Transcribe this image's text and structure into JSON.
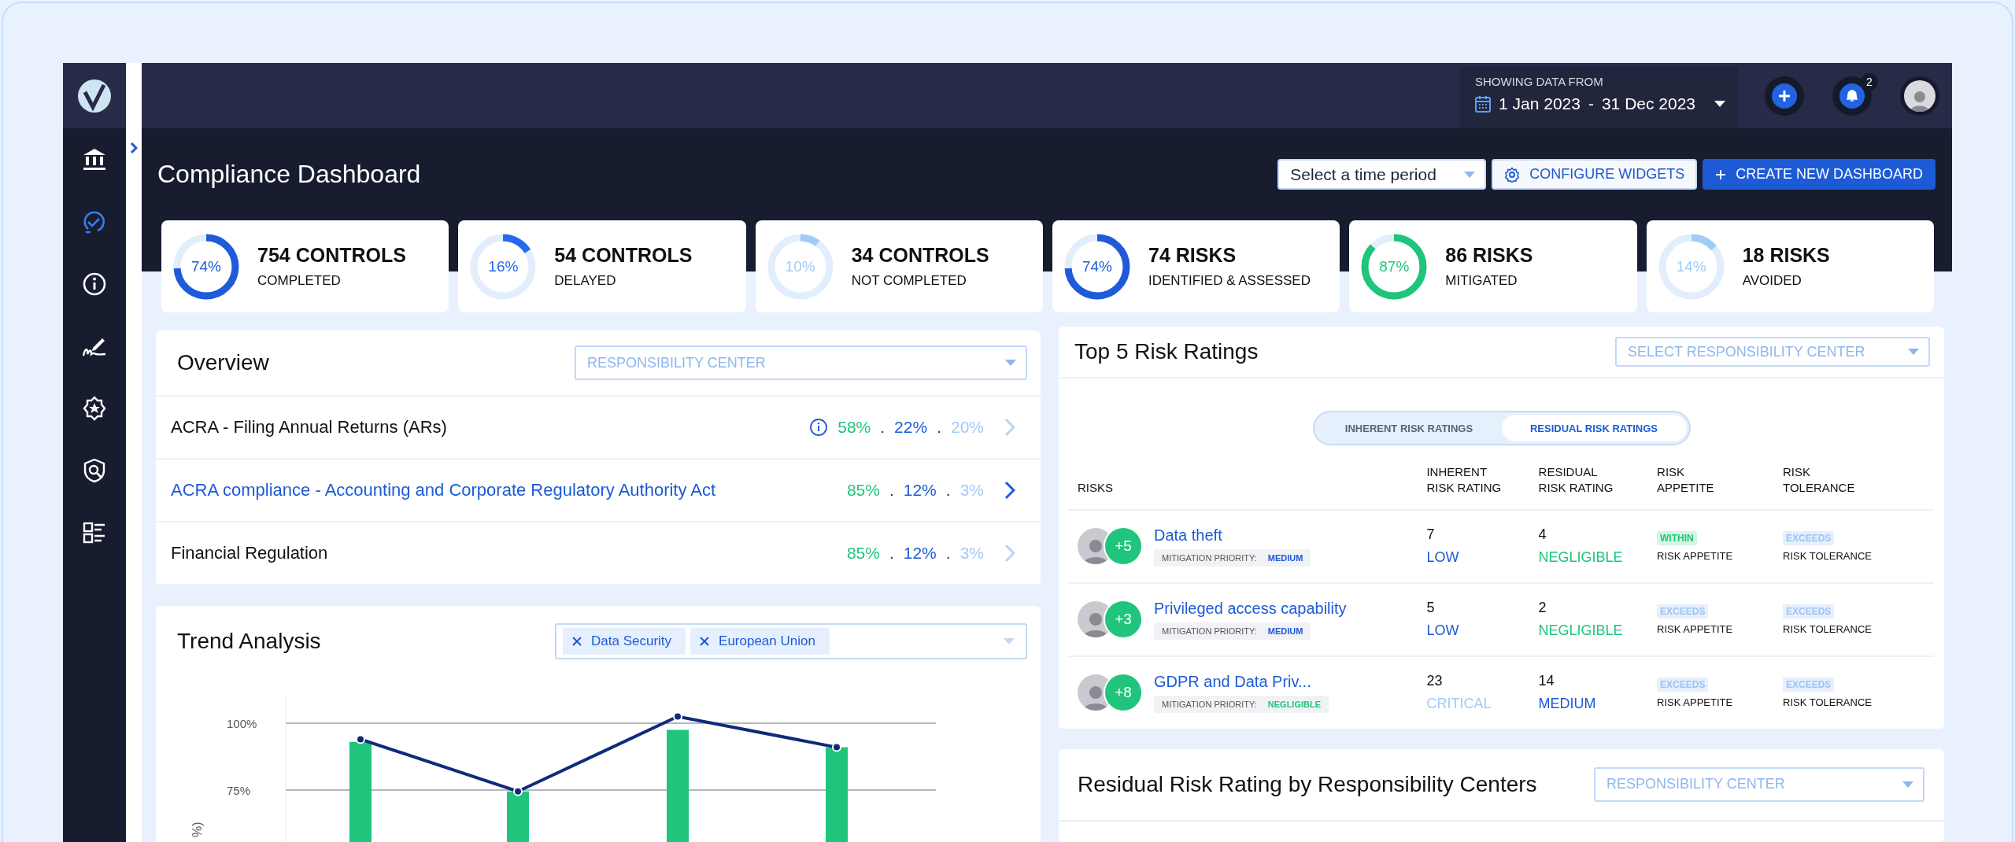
{
  "header": {
    "date_label": "SHOWING DATA FROM",
    "date_start": "1 Jan 2023",
    "date_separator": "-",
    "date_end": "31 Dec 2023",
    "notification_count": "2"
  },
  "sidebar": {
    "items": [
      {
        "kind": "bank",
        "selected": false
      },
      {
        "kind": "check",
        "selected": true
      },
      {
        "kind": "info",
        "selected": false
      },
      {
        "kind": "signature",
        "selected": false
      },
      {
        "kind": "badge",
        "selected": false
      },
      {
        "kind": "shield",
        "selected": false
      },
      {
        "kind": "list",
        "selected": false
      }
    ]
  },
  "page": {
    "title": "Compliance Dashboard",
    "time_period": {
      "placeholder": "Select a time period"
    },
    "buttons": [
      {
        "label": "CONFIGURE WIDGETS",
        "kind": "configure"
      },
      {
        "label": "CREATE NEW DASHBOARD",
        "kind": "create"
      }
    ]
  },
  "kpis": [
    {
      "percent": "74%",
      "level": 0.74,
      "color": "#1f5ad8",
      "value": "754 CONTROLS",
      "label": "COMPLETED"
    },
    {
      "percent": "16%",
      "level": 0.16,
      "color": "#2569f0",
      "value": "54 CONTROLS",
      "label": "DELAYED"
    },
    {
      "percent": "10%",
      "level": 0.1,
      "color": "#a1cbf8",
      "value": "34 CONTROLS",
      "label": "NOT COMPLETED"
    },
    {
      "percent": "74%",
      "level": 0.74,
      "color": "#1f5ad8",
      "value": "74 RISKS",
      "label": "IDENTIFIED & ASSESSED"
    },
    {
      "percent": "87%",
      "level": 0.87,
      "color": "#20c47c",
      "value": "86 RISKS",
      "label": "MITIGATED"
    },
    {
      "percent": "14%",
      "level": 0.14,
      "color": "#a1cbf8",
      "value": "18 RISKS",
      "label": "AVOIDED"
    }
  ],
  "overview": {
    "title": "Overview",
    "filter": {
      "placeholder": "RESPONSIBILITY CENTER"
    },
    "separator": ".",
    "rows": [
      {
        "name": "ACRA - Filing Annual Returns (ARs)",
        "selected": false,
        "info": true,
        "value_1": "58%",
        "value_2": "22%",
        "value_3": "20%"
      },
      {
        "name": "ACRA compliance - Accounting and Corporate Regulatory Authority Act",
        "selected": true,
        "info": false,
        "value_1": "85%",
        "value_2": "12%",
        "value_3": "3%"
      },
      {
        "name": "Financial Regulation",
        "selected": false,
        "info": false,
        "value_1": "85%",
        "value_2": "12%",
        "value_3": "3%"
      }
    ]
  },
  "trend": {
    "title": "Trend Analysis",
    "filters": [
      {
        "label": "Data Security"
      },
      {
        "label": "European Union"
      }
    ],
    "chart_data": {
      "type": "bar",
      "ylabel": "%)",
      "ylim": [
        0,
        110
      ],
      "yticks": [
        {
          "value": 75,
          "label": "75%"
        },
        {
          "value": 100,
          "label": "100%"
        }
      ],
      "series": [
        {
          "type": "bar",
          "color": "#20c47c",
          "values": [
            93,
            74.5,
            97.5,
            91
          ]
        },
        {
          "type": "line",
          "color": "#0d2b7a",
          "marker": true,
          "values": [
            94,
            74.5,
            102.5,
            91
          ]
        }
      ]
    }
  },
  "top_risks": {
    "title": "Top 5 Risk Ratings",
    "filter": {
      "placeholder": "SELECT RESPONSIBILITY CENTER"
    },
    "toggle": [
      {
        "label": "INHERENT RISK RATINGS",
        "selected": false
      },
      {
        "label": "RESIDUAL RISK RATINGS",
        "selected": true
      }
    ],
    "columns": [
      "RISKS",
      "INHERENT\nRISK RATING",
      "RESIDUAL\nRISK RATING",
      "RISK\nAPPETITE",
      "RISK\nTOLERANCE"
    ],
    "rows": [
      {
        "extra_count": "+5",
        "name": "Data theft",
        "priority": {
          "label": "MITIGATION PRIORITY:",
          "value": "MEDIUM",
          "color": "#1d5ad6"
        },
        "inherent": {
          "score": "7",
          "rating": "LOW",
          "color": "#1d5ad6"
        },
        "residual": {
          "score": "4",
          "rating": "NEGLIGIBLE",
          "color": "#20c47c"
        },
        "appetite": {
          "status": "WITHIN",
          "exceeded": false,
          "label": "RISK APPETITE"
        },
        "tolerance": {
          "status": "EXCEEDS",
          "exceeded": true,
          "label": "RISK TOLERANCE"
        }
      },
      {
        "extra_count": "+3",
        "name": "Privileged access capability",
        "priority": {
          "label": "MITIGATION PRIORITY:",
          "value": "MEDIUM",
          "color": "#1d5ad6"
        },
        "inherent": {
          "score": "5",
          "rating": "LOW",
          "color": "#1d5ad6"
        },
        "residual": {
          "score": "2",
          "rating": "NEGLIGIBLE",
          "color": "#20c47c"
        },
        "appetite": {
          "status": "EXCEEDS",
          "exceeded": true,
          "label": "RISK APPETITE"
        },
        "tolerance": {
          "status": "EXCEEDS",
          "exceeded": true,
          "label": "RISK TOLERANCE"
        }
      },
      {
        "extra_count": "+8",
        "name": "GDPR and Data Priv...",
        "priority": {
          "label": "MITIGATION PRIORITY:",
          "value": "NEGLIGIBLE",
          "color": "#20c47c"
        },
        "inherent": {
          "score": "23",
          "rating": "CRITICAL",
          "color": "#a1cbf8"
        },
        "residual": {
          "score": "14",
          "rating": "MEDIUM",
          "color": "#1d5ad6"
        },
        "appetite": {
          "status": "EXCEEDS",
          "exceeded": true,
          "label": "RISK APPETITE"
        },
        "tolerance": {
          "status": "EXCEEDS",
          "exceeded": true,
          "label": "RISK TOLERANCE"
        }
      }
    ]
  },
  "residual": {
    "title": "Residual Risk Rating by Responsibility Centers",
    "filter": {
      "placeholder": "RESPONSIBILITY CENTER"
    }
  }
}
